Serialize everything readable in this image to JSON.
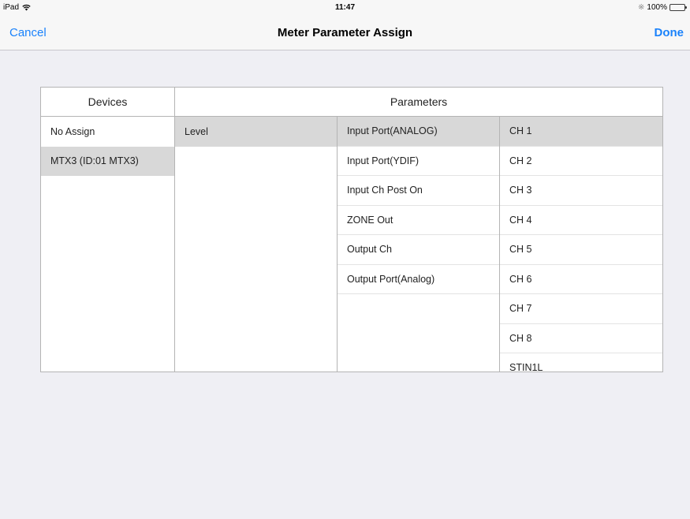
{
  "status_bar": {
    "device": "iPad",
    "time": "11:47",
    "battery": "100%"
  },
  "nav": {
    "cancel": "Cancel",
    "title": "Meter Parameter Assign",
    "done": "Done"
  },
  "table": {
    "devices_header": "Devices",
    "parameters_header": "Parameters",
    "devices": [
      {
        "label": "No Assign"
      },
      {
        "label": "MTX3 (ID:01 MTX3)"
      }
    ],
    "param_types": [
      {
        "label": "Level"
      }
    ],
    "param_sources": [
      {
        "label": "Input Port(ANALOG)"
      },
      {
        "label": "Input Port(YDIF)"
      },
      {
        "label": "Input Ch Post On"
      },
      {
        "label": "ZONE Out"
      },
      {
        "label": "Output Ch"
      },
      {
        "label": "Output Port(Analog)"
      }
    ],
    "channels": [
      {
        "label": "CH 1"
      },
      {
        "label": "CH 2"
      },
      {
        "label": "CH 3"
      },
      {
        "label": "CH 4"
      },
      {
        "label": "CH 5"
      },
      {
        "label": "CH 6"
      },
      {
        "label": "CH 7"
      },
      {
        "label": "CH 8"
      },
      {
        "label": "STIN1L"
      }
    ]
  }
}
